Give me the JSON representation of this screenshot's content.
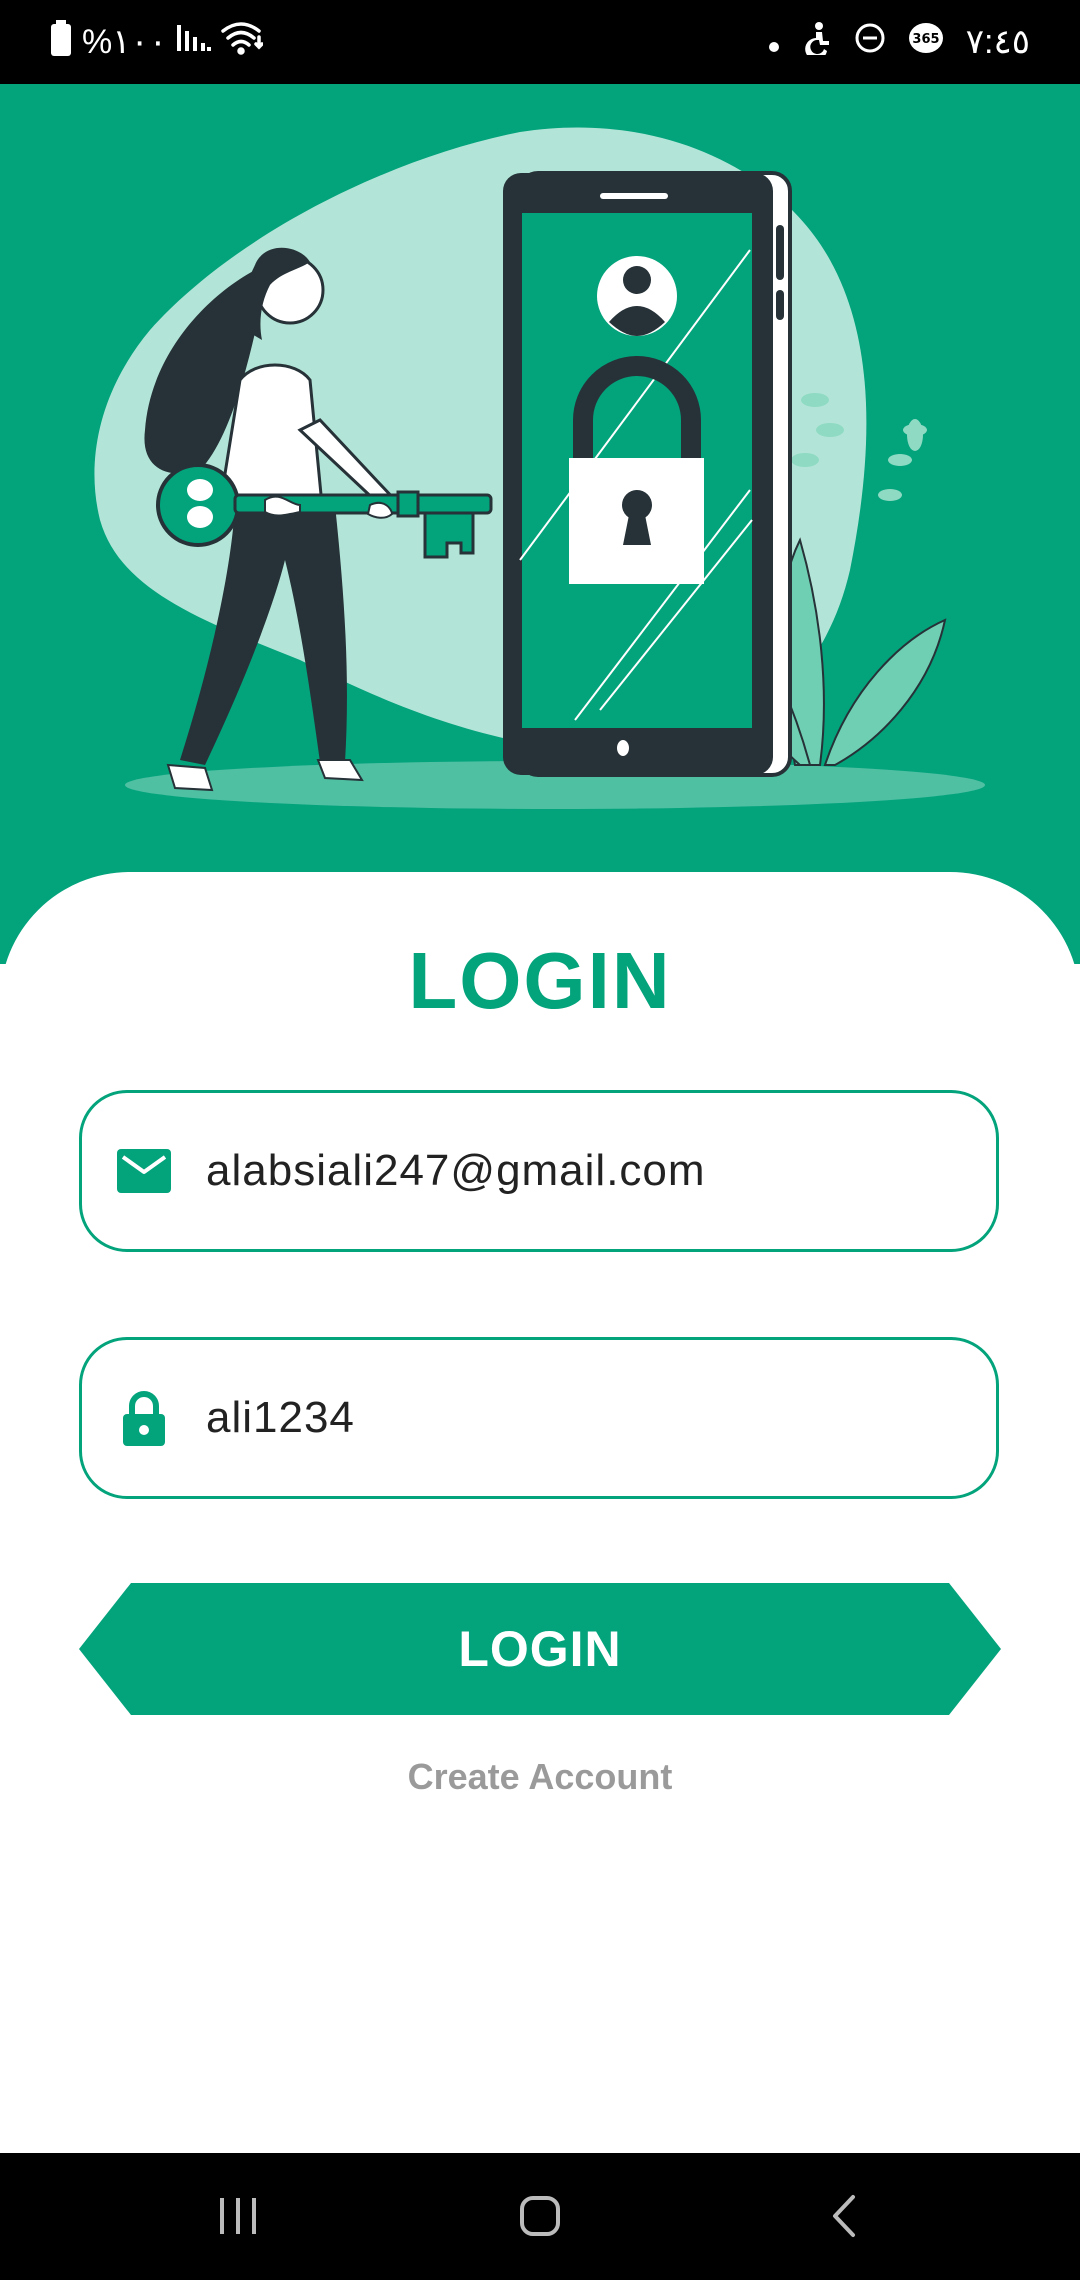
{
  "status_bar": {
    "battery_text": "%١٠٠",
    "time": "٧:٤٥",
    "icons": [
      "battery-icon",
      "signal-icon",
      "wifi-icon",
      "dot-icon",
      "accessibility-icon",
      "dnd-icon",
      "office365-icon"
    ]
  },
  "login": {
    "title": "LOGIN",
    "email_value": "alabsiali247@gmail.com",
    "password_value": "ali1234",
    "button_label": "LOGIN",
    "create_account": "Create Account"
  },
  "colors": {
    "primary": "#03A37C",
    "dark": "#263238",
    "light_green": "#B2E5D7"
  },
  "nav": {
    "icons": [
      "recent-apps-icon",
      "home-icon",
      "back-icon"
    ]
  }
}
